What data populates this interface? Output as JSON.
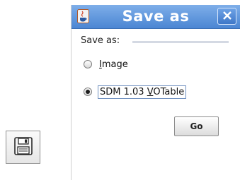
{
  "icons": {
    "save_button_icon": "floppy-disk-icon",
    "window_icon": "java-icon",
    "close_icon": "close-icon"
  },
  "dialog": {
    "title": "Save as",
    "section_label": "Save as:",
    "options": [
      {
        "label_pre": "",
        "label_mnemonic": "I",
        "label_post": "mage",
        "selected": false
      },
      {
        "label_pre": "SDM 1.03 ",
        "label_mnemonic": "V",
        "label_post": "OTable",
        "selected": true
      }
    ],
    "go_label": "Go"
  },
  "colors": {
    "titlebar": "#4b86d3",
    "dialog_background": "#ffffff"
  }
}
